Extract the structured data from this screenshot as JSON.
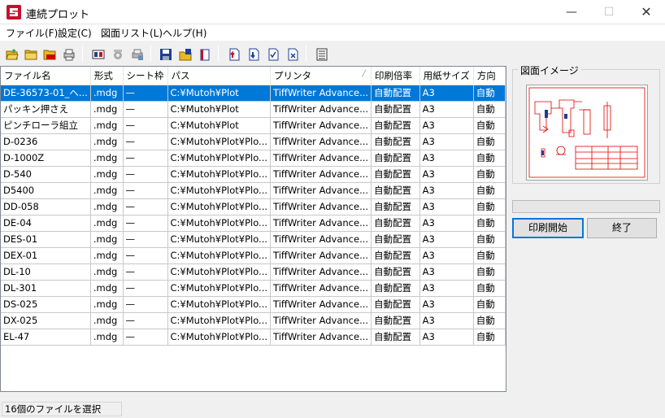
{
  "window": {
    "title": "連続プロット",
    "minimize": "—",
    "maximize": "☐",
    "close": "✕"
  },
  "menu": [
    "ファイル(F)",
    "設定(C)",
    "図面リスト(L)",
    "ヘルプ(H)"
  ],
  "toolbar": {
    "icons": [
      "folder-open-icon",
      "folder-icon",
      "folder-delete-icon",
      "print-icon",
      "plotter-settings-icon",
      "gear-disabled-icon",
      "printer-disabled-icon",
      "save-icon",
      "save-as-icon",
      "page-icon",
      "move-up-icon",
      "move-down-icon",
      "check-file-icon",
      "delete-file-icon",
      "list-icon"
    ]
  },
  "table": {
    "headers": [
      "ファイル名",
      "形式",
      "シート枠",
      "パス",
      "プリンタ",
      "印刷倍率",
      "用紙サイズ",
      "方向"
    ],
    "rows": [
      [
        "DE-36573-01_へ...",
        ".mdg",
        "—",
        "C:¥Mutoh¥Plot",
        "TiffWriter Advance...",
        "自動配置",
        "A3",
        "自動"
      ],
      [
        "パッキン押さえ",
        ".mdg",
        "—",
        "C:¥Mutoh¥Plot",
        "TiffWriter Advance...",
        "自動配置",
        "A3",
        "自動"
      ],
      [
        "ピンチローラ組立",
        ".mdg",
        "—",
        "C:¥Mutoh¥Plot",
        "TiffWriter Advance...",
        "自動配置",
        "A3",
        "自動"
      ],
      [
        "D-0236",
        ".mdg",
        "—",
        "C:¥Mutoh¥Plot¥Plo...",
        "TiffWriter Advance...",
        "自動配置",
        "A3",
        "自動"
      ],
      [
        "D-1000Z",
        ".mdg",
        "—",
        "C:¥Mutoh¥Plot¥Plo...",
        "TiffWriter Advance...",
        "自動配置",
        "A3",
        "自動"
      ],
      [
        "D-540",
        ".mdg",
        "—",
        "C:¥Mutoh¥Plot¥Plo...",
        "TiffWriter Advance...",
        "自動配置",
        "A3",
        "自動"
      ],
      [
        "D5400",
        ".mdg",
        "—",
        "C:¥Mutoh¥Plot¥Plo...",
        "TiffWriter Advance...",
        "自動配置",
        "A3",
        "自動"
      ],
      [
        "DD-058",
        ".mdg",
        "—",
        "C:¥Mutoh¥Plot¥Plo...",
        "TiffWriter Advance...",
        "自動配置",
        "A3",
        "自動"
      ],
      [
        "DE-04",
        ".mdg",
        "—",
        "C:¥Mutoh¥Plot¥Plo...",
        "TiffWriter Advance...",
        "自動配置",
        "A3",
        "自動"
      ],
      [
        "DES-01",
        ".mdg",
        "—",
        "C:¥Mutoh¥Plot¥Plo...",
        "TiffWriter Advance...",
        "自動配置",
        "A3",
        "自動"
      ],
      [
        "DEX-01",
        ".mdg",
        "—",
        "C:¥Mutoh¥Plot¥Plo...",
        "TiffWriter Advance...",
        "自動配置",
        "A3",
        "自動"
      ],
      [
        "DL-10",
        ".mdg",
        "—",
        "C:¥Mutoh¥Plot¥Plo...",
        "TiffWriter Advance...",
        "自動配置",
        "A3",
        "自動"
      ],
      [
        "DL-301",
        ".mdg",
        "—",
        "C:¥Mutoh¥Plot¥Plo...",
        "TiffWriter Advance...",
        "自動配置",
        "A3",
        "自動"
      ],
      [
        "DS-025",
        ".mdg",
        "—",
        "C:¥Mutoh¥Plot¥Plo...",
        "TiffWriter Advance...",
        "自動配置",
        "A3",
        "自動"
      ],
      [
        "DX-025",
        ".mdg",
        "—",
        "C:¥Mutoh¥Plot¥Plo...",
        "TiffWriter Advance...",
        "自動配置",
        "A3",
        "自動"
      ],
      [
        "EL-47",
        ".mdg",
        "—",
        "C:¥Mutoh¥Plot¥Plo...",
        "TiffWriter Advance...",
        "自動配置",
        "A3",
        "自動"
      ]
    ],
    "selected_row": 0
  },
  "image_panel": {
    "label": "図面イメージ"
  },
  "buttons": {
    "start_print": "印刷開始",
    "exit": "終了"
  },
  "status": {
    "text": "16個のファイルを選択"
  },
  "colors": {
    "selection": "#0078d7",
    "drawing_red": "#e00000"
  }
}
